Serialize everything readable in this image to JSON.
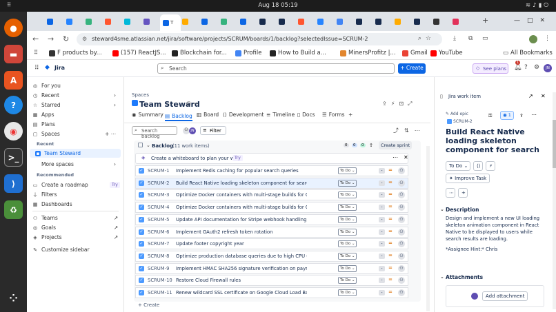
{
  "system": {
    "activities_icon": "grid-icon",
    "clock": "Aug 18  05:19",
    "tray": [
      "wifi-icon",
      "volume-icon",
      "battery-icon",
      "power-icon"
    ]
  },
  "browser": {
    "tab_favicons": [
      "#0c66e4",
      "#2684ff",
      "#36b37e",
      "#ff5630",
      "#00b8d9",
      "#6554c0",
      "#0c66e4",
      "#ffab00",
      "#0c66e4",
      "#36b37e",
      "#0c66e4",
      "#172b4d",
      "#172b4d",
      "#ff5630",
      "#2684ff",
      "#4285f4",
      "#172b4d",
      "#172b4d",
      "#ffab00",
      "#172b4d",
      "#333333",
      "#e2325a"
    ],
    "active_tab_label": "T",
    "url": "steward4sme.atlassian.net/jira/software/projects/SCRUM/boards/1/backlog?selectedIssue=SCRUM-2",
    "bookmarks": [
      {
        "label": "F products by...",
        "color": "#333333"
      },
      {
        "label": "(157) ReactJS...",
        "color": "#ff0000"
      },
      {
        "label": "Blockchain for...",
        "color": "#222222"
      },
      {
        "label": "Profile",
        "color": "#4285f4"
      },
      {
        "label": "How to Build a...",
        "color": "#222222"
      },
      {
        "label": "MinersProfitz |...",
        "color": "#e2862e"
      },
      {
        "label": "Gmail",
        "color": "#ea4335"
      },
      {
        "label": "YouTube",
        "color": "#ff0000"
      }
    ],
    "all_bookmarks": "All Bookmarks"
  },
  "jira": {
    "app_name": "Jira",
    "search_placeholder": "Search",
    "create_label": "+ Create",
    "see_plans": "See plans",
    "notif_count": "1",
    "avatar": "JN",
    "sidebar": {
      "items_top": [
        "For you",
        "Recent",
        "Starred",
        "Apps",
        "Plans",
        "Spaces"
      ],
      "recent_heading": "Recent",
      "project": "Team Steward",
      "more_spaces": "More spaces",
      "recommended_heading": "Recommended",
      "roadmap": "Create a roadmap",
      "try_badge": "Try",
      "items_bottom": [
        "Filters",
        "Dashboards",
        "Teams",
        "Goals",
        "Projects",
        "Customize sidebar"
      ]
    },
    "breadcrumb": "Spaces",
    "project_title": "Team Steward",
    "tabs": [
      "Summary",
      "Backlog",
      "Board",
      "Development",
      "Timeline",
      "Docs",
      "Forms",
      "+"
    ],
    "search_backlog": "Search backlog",
    "filter_label": "Filter",
    "backlog_label": "Backlog",
    "work_items_count": "(11 work items)",
    "counts": [
      "0",
      "0",
      "0"
    ],
    "create_sprint": "Create sprint",
    "whiteboard_prompt": "Create a whiteboard to plan your work",
    "whiteboard_try": "Try",
    "create_item": "+ Create",
    "status_default": "To Do",
    "issues": [
      {
        "key": "SCRUM-1",
        "summary": "Implement Redis caching for popular search queries"
      },
      {
        "key": "SCRUM-2",
        "summary": "Build React Native loading skeleton component for search"
      },
      {
        "key": "SCRUM-3",
        "summary": "Optimize Docker containers with multi-stage builds for Cloud..."
      },
      {
        "key": "SCRUM-4",
        "summary": "Optimize Docker containers with multi-stage builds for Cloud..."
      },
      {
        "key": "SCRUM-5",
        "summary": "Update API documentation for Stripe webhook handling"
      },
      {
        "key": "SCRUM-6",
        "summary": "Implement OAuth2 refresh token rotation"
      },
      {
        "key": "SCRUM-7",
        "summary": "Update footer copyright year"
      },
      {
        "key": "SCRUM-8",
        "summary": "Optimize production database queries due to high CPU usage"
      },
      {
        "key": "SCRUM-9",
        "summary": "Implement HMAC SHA256 signature verification on payment..."
      },
      {
        "key": "SCRUM-10",
        "summary": "Restore Cloud Firewall rules"
      },
      {
        "key": "SCRUM-11",
        "summary": "Renew wildcard SSL certificate on Google Cloud Load Bala..."
      }
    ],
    "panel": {
      "header": "Jira work item",
      "add_epic": "Add epic",
      "issue_key": "SCRUM-2",
      "watch_count": "1",
      "title": "Build React Native loading skeleton component for search",
      "status": "To Do",
      "improve": "Improve Task",
      "description_heading": "Description",
      "description": "Design and implement a new UI loading skeleton animation component in React Native to be displayed to users while search results are loading.",
      "assignee_hint": "*Assignee Hint:* Chris",
      "attachments_heading": "Attachments",
      "add_attachment": "Add attachment"
    }
  }
}
